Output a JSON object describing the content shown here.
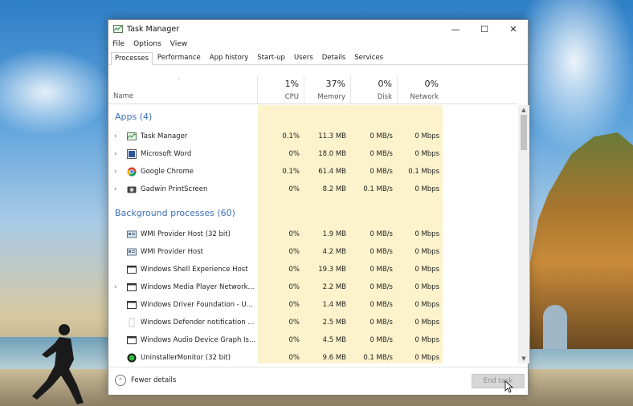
{
  "window": {
    "title": "Task Manager",
    "minimize": "—",
    "maximize": "☐",
    "close": "✕"
  },
  "menu": [
    "File",
    "Options",
    "View"
  ],
  "tabs": [
    "Processes",
    "Performance",
    "App history",
    "Start-up",
    "Users",
    "Details",
    "Services"
  ],
  "active_tab": "Processes",
  "columns": {
    "name": "Name",
    "sort_indicator": "ˆ",
    "cpu": {
      "pct": "1%",
      "label": "CPU"
    },
    "memory": {
      "pct": "37%",
      "label": "Memory"
    },
    "disk": {
      "pct": "0%",
      "label": "Disk"
    },
    "network": {
      "pct": "0%",
      "label": "Network"
    }
  },
  "groups": {
    "apps": "Apps (4)",
    "background": "Background processes (60)"
  },
  "apps": [
    {
      "name": "Task Manager",
      "icon": "task-manager-icon",
      "cpu": "0.1%",
      "mem": "11.3 MB",
      "disk": "0 MB/s",
      "net": "0 Mbps"
    },
    {
      "name": "Microsoft Word",
      "icon": "word-icon",
      "cpu": "0%",
      "mem": "18.0 MB",
      "disk": "0 MB/s",
      "net": "0 Mbps"
    },
    {
      "name": "Google Chrome",
      "icon": "chrome-icon",
      "cpu": "0.1%",
      "mem": "61.4 MB",
      "disk": "0 MB/s",
      "net": "0.1 Mbps"
    },
    {
      "name": "Gadwin PrintScreen",
      "icon": "printscreen-icon",
      "cpu": "0%",
      "mem": "8.2 MB",
      "disk": "0.1 MB/s",
      "net": "0 Mbps"
    }
  ],
  "background": [
    {
      "name": "WMI Provider Host (32 bit)",
      "icon": "service-icon",
      "cpu": "0%",
      "mem": "1.9 MB",
      "disk": "0 MB/s",
      "net": "0 Mbps",
      "expandable": false
    },
    {
      "name": "WMI Provider Host",
      "icon": "service-icon",
      "cpu": "0%",
      "mem": "4.2 MB",
      "disk": "0 MB/s",
      "net": "0 Mbps",
      "expandable": false
    },
    {
      "name": "Windows Shell Experience Host",
      "icon": "window-icon",
      "cpu": "0%",
      "mem": "19.3 MB",
      "disk": "0 MB/s",
      "net": "0 Mbps",
      "expandable": false
    },
    {
      "name": "Windows Media Player Network...",
      "icon": "window-icon",
      "cpu": "0%",
      "mem": "2.2 MB",
      "disk": "0 MB/s",
      "net": "0 Mbps",
      "expandable": true
    },
    {
      "name": "Windows Driver Foundation - U...",
      "icon": "window-icon",
      "cpu": "0%",
      "mem": "1.4 MB",
      "disk": "0 MB/s",
      "net": "0 Mbps",
      "expandable": false
    },
    {
      "name": "Windows Defender notification ...",
      "icon": "blank-icon",
      "cpu": "0%",
      "mem": "2.5 MB",
      "disk": "0 MB/s",
      "net": "0 Mbps",
      "expandable": false
    },
    {
      "name": "Windows Audio Device Graph Is...",
      "icon": "window-icon",
      "cpu": "0%",
      "mem": "4.5 MB",
      "disk": "0 MB/s",
      "net": "0 Mbps",
      "expandable": false
    },
    {
      "name": "UninstallerMonitor (32 bit)",
      "icon": "green-circle-icon",
      "cpu": "0%",
      "mem": "9.6 MB",
      "disk": "0.1 MB/s",
      "net": "0 Mbps",
      "expandable": false
    }
  ],
  "footer": {
    "fewer_details": "Fewer details",
    "end_task": "End task"
  },
  "colors": {
    "group_header": "#3b6fb6",
    "highlight_col": "#fcf3cc"
  }
}
